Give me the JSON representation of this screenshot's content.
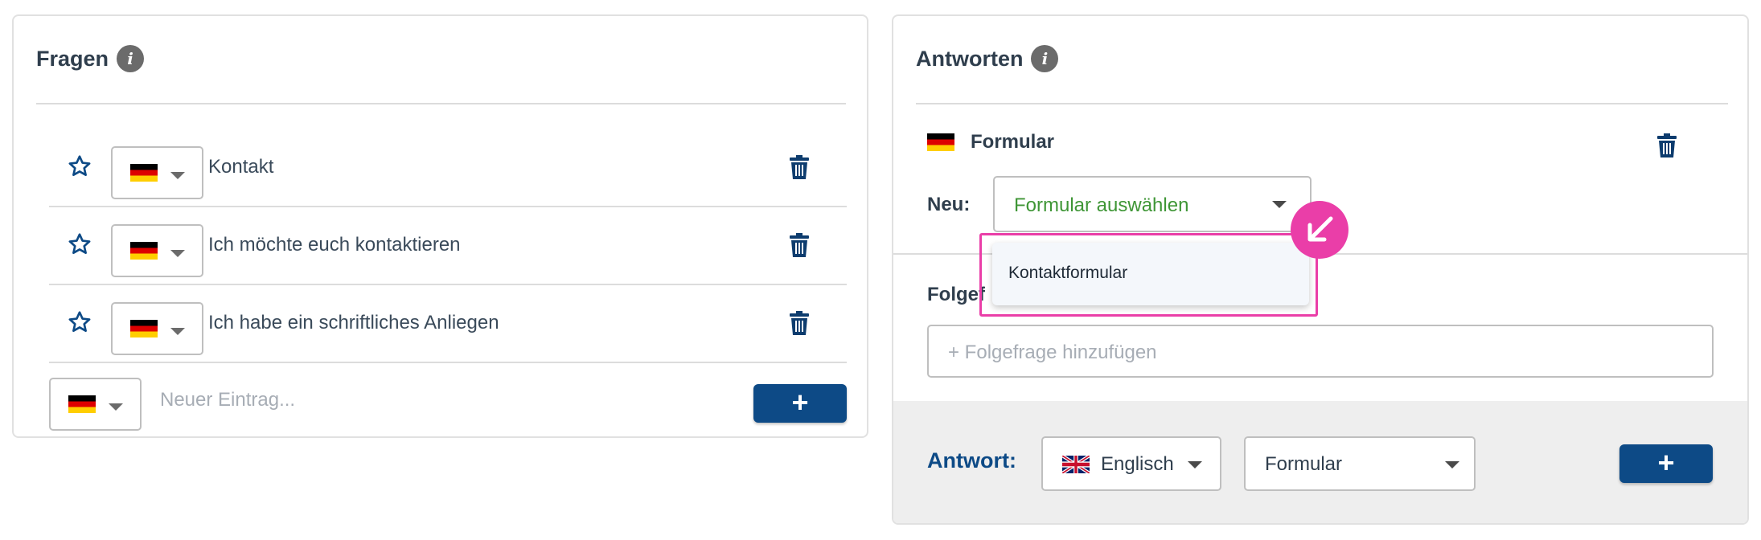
{
  "questions_panel": {
    "title": "Fragen",
    "rows": [
      {
        "language": "Deutsch",
        "text": "Kontakt"
      },
      {
        "language": "Deutsch",
        "text": "Ich möchte euch kontaktieren"
      },
      {
        "language": "Deutsch",
        "text": "Ich habe ein schriftliches Anliegen"
      }
    ],
    "new_entry_placeholder": "Neuer Eintrag...",
    "add_button": "+"
  },
  "answers_panel": {
    "title": "Antworten",
    "answer_type_label": "Formular",
    "new_label": "Neu:",
    "form_select_value": "Formular auswählen",
    "followup_label": "Folgefragen",
    "followup_label_visible": "Folgef",
    "followup_placeholder": "+ Folgefrage hinzufügen",
    "footer": {
      "label": "Antwort:",
      "language": "Englisch",
      "type": "Formular",
      "add_button": "+"
    }
  },
  "dropdown": {
    "options": [
      "Kontaktformular"
    ]
  },
  "colors": {
    "primary": "#0d4a86",
    "highlight": "#ea3ea8",
    "select_value_green": "#3f9636"
  }
}
